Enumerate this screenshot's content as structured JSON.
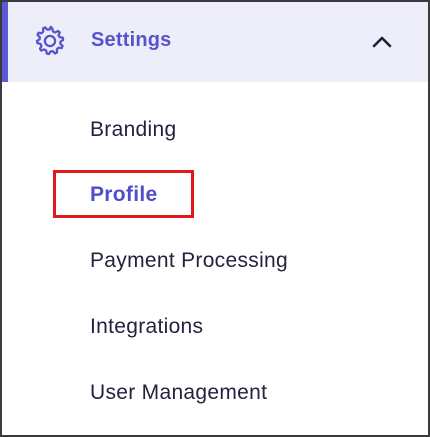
{
  "settings": {
    "label": "Settings",
    "expanded": true,
    "icon": "gear-icon",
    "chevron_icon": "chevron-up-icon",
    "accent_color": "#5b59d6",
    "header_bg": "#eeeefb"
  },
  "submenu": {
    "items": [
      {
        "label": "Branding",
        "active": false
      },
      {
        "label": "Profile",
        "active": true
      },
      {
        "label": "Payment Processing",
        "active": false
      },
      {
        "label": "Integrations",
        "active": false
      },
      {
        "label": "User Management",
        "active": false
      }
    ]
  },
  "highlight": {
    "color": "#e0191f",
    "target": "Profile"
  }
}
